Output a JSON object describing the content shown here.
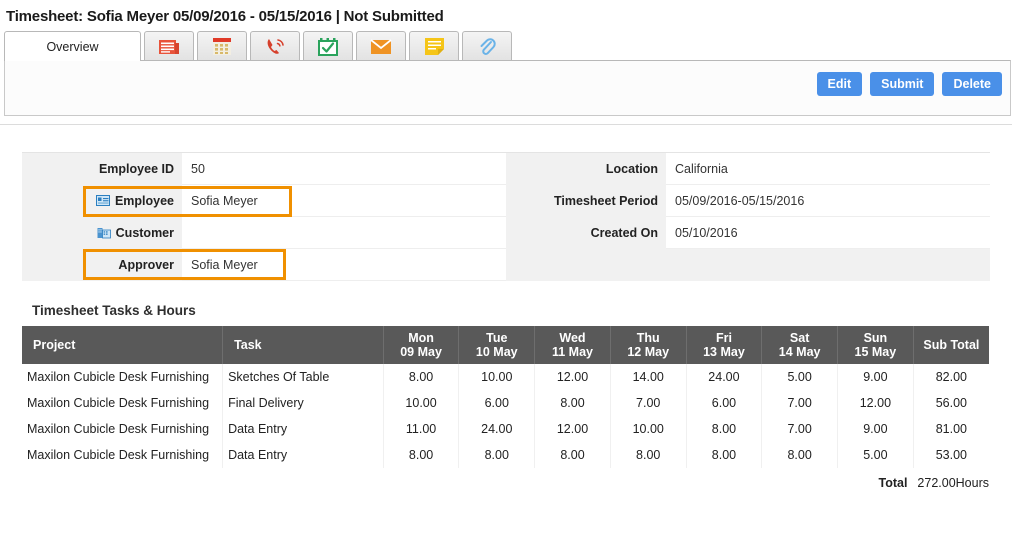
{
  "page": {
    "title": "Timesheet: Sofia Meyer 05/09/2016 - 05/15/2016 | Not Submitted"
  },
  "tabs": [
    {
      "label": "Overview",
      "icon": "overview-text",
      "active": true
    },
    {
      "label": "",
      "icon": "news-icon",
      "active": false
    },
    {
      "label": "",
      "icon": "calendar-icon",
      "active": false
    },
    {
      "label": "",
      "icon": "phone-icon",
      "active": false
    },
    {
      "label": "",
      "icon": "calendar-check-icon",
      "active": false
    },
    {
      "label": "",
      "icon": "envelope-icon",
      "active": false
    },
    {
      "label": "",
      "icon": "note-icon",
      "active": false
    },
    {
      "label": "",
      "icon": "paperclip-icon",
      "active": false
    }
  ],
  "actions": {
    "edit_label": "Edit",
    "submit_label": "Submit",
    "delete_label": "Delete",
    "button_color": "#4a90e8"
  },
  "details": {
    "left": [
      {
        "label": "Employee ID",
        "value": "50",
        "icon": null,
        "highlighted": false
      },
      {
        "label": "Employee",
        "value": "Sofia Meyer",
        "icon": "id-card-icon",
        "highlighted": true
      },
      {
        "label": "Customer",
        "value": "",
        "icon": "building-icon",
        "highlighted": false
      },
      {
        "label": "Approver",
        "value": "Sofia Meyer",
        "icon": null,
        "highlighted": true
      }
    ],
    "right": [
      {
        "label": "Location",
        "value": "California"
      },
      {
        "label": "Timesheet Period",
        "value": "05/09/2016-05/15/2016"
      },
      {
        "label": "Created On",
        "value": "05/10/2016"
      }
    ],
    "highlight_color": "#f09000"
  },
  "table": {
    "section_title": "Timesheet Tasks & Hours",
    "headers": [
      {
        "line1": "Project",
        "line2": ""
      },
      {
        "line1": "Task",
        "line2": ""
      },
      {
        "line1": "Mon",
        "line2": "09 May"
      },
      {
        "line1": "Tue",
        "line2": "10 May"
      },
      {
        "line1": "Wed",
        "line2": "11 May"
      },
      {
        "line1": "Thu",
        "line2": "12 May"
      },
      {
        "line1": "Fri",
        "line2": "13 May"
      },
      {
        "line1": "Sat",
        "line2": "14 May"
      },
      {
        "line1": "Sun",
        "line2": "15 May"
      },
      {
        "line1": "Sub Total",
        "line2": ""
      }
    ],
    "rows": [
      {
        "project": "Maxilon Cubicle Desk Furnishing",
        "task": "Sketches Of Table",
        "hours": [
          "8.00",
          "10.00",
          "12.00",
          "14.00",
          "24.00",
          "5.00",
          "9.00"
        ],
        "subtotal": "82.00"
      },
      {
        "project": "Maxilon Cubicle Desk Furnishing",
        "task": "Final Delivery",
        "hours": [
          "10.00",
          "6.00",
          "8.00",
          "7.00",
          "6.00",
          "7.00",
          "12.00"
        ],
        "subtotal": "56.00"
      },
      {
        "project": "Maxilon Cubicle Desk Furnishing",
        "task": "Data Entry",
        "hours": [
          "11.00",
          "24.00",
          "12.00",
          "10.00",
          "8.00",
          "7.00",
          "9.00"
        ],
        "subtotal": "81.00"
      },
      {
        "project": "Maxilon Cubicle Desk Furnishing",
        "task": "Data Entry",
        "hours": [
          "8.00",
          "8.00",
          "8.00",
          "8.00",
          "8.00",
          "8.00",
          "5.00"
        ],
        "subtotal": "53.00"
      }
    ],
    "total_label": "Total",
    "total_value": "272.00Hours"
  }
}
